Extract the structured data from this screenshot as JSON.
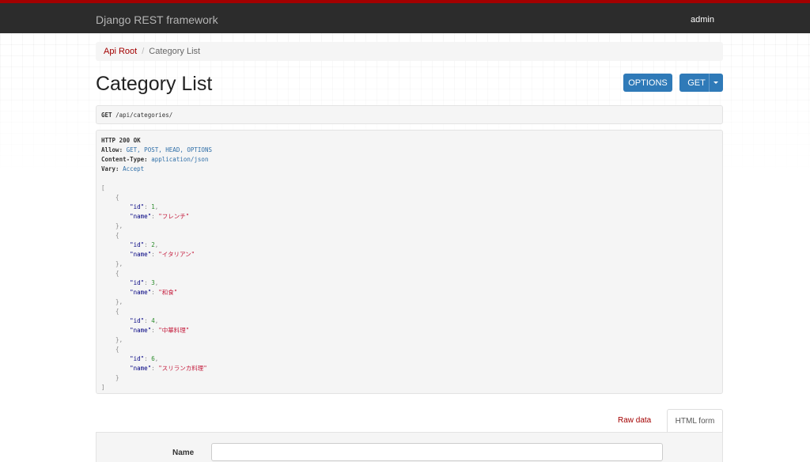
{
  "topbar": {
    "brand": "Django REST framework",
    "user": "admin"
  },
  "breadcrumb": {
    "root": "Api Root",
    "separator": "/",
    "current": "Category List"
  },
  "page": {
    "title": "Category List"
  },
  "actions": {
    "options_label": "OPTIONS",
    "get_label": "GET"
  },
  "request": {
    "method": "GET",
    "path": "/api/categories/"
  },
  "response": {
    "status": "HTTP 200 OK",
    "allow_key": "Allow:",
    "allow_value": "GET, POST, HEAD, OPTIONS",
    "content_type_key": "Content-Type:",
    "content_type_value": "application/json",
    "vary_key": "Vary:",
    "vary_value": "Accept",
    "items": [
      {
        "id": "1",
        "name": "\"フレンチ\""
      },
      {
        "id": "2",
        "name": "\"イタリアン\""
      },
      {
        "id": "3",
        "name": "\"和食\""
      },
      {
        "id": "4",
        "name": "\"中華料理\""
      },
      {
        "id": "6",
        "name": "\"スリランカ料理\""
      }
    ]
  },
  "tabs": {
    "raw": "Raw data",
    "html": "HTML form"
  },
  "form": {
    "name_label": "Name",
    "name_value": ""
  },
  "colors": {
    "accent": "#a30000",
    "button": "#2f7ab8",
    "topbar": "#2c2c2c"
  }
}
